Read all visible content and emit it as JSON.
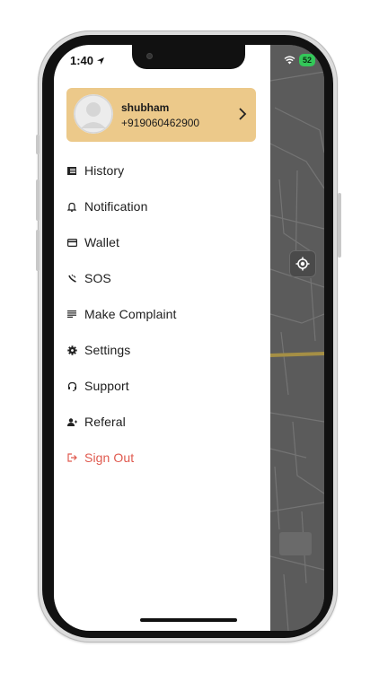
{
  "status_bar": {
    "time": "1:40",
    "battery": "52"
  },
  "profile": {
    "name": "shubham",
    "phone": "+919060462900"
  },
  "menu": [
    {
      "label": "History",
      "icon": "list-icon"
    },
    {
      "label": "Notification",
      "icon": "bell-icon"
    },
    {
      "label": "Wallet",
      "icon": "card-icon"
    },
    {
      "label": "SOS",
      "icon": "sos-icon"
    },
    {
      "label": "Make Complaint",
      "icon": "notes-icon"
    },
    {
      "label": "Settings",
      "icon": "gear-icon"
    },
    {
      "label": "Support",
      "icon": "headset-icon"
    },
    {
      "label": "Referal",
      "icon": "users-icon"
    },
    {
      "label": "Sign Out",
      "icon": "logout-icon"
    }
  ],
  "colors": {
    "profile_card": "#ecc98a",
    "sign_out": "#e05a4f",
    "map_background": "#5b5b5b"
  }
}
